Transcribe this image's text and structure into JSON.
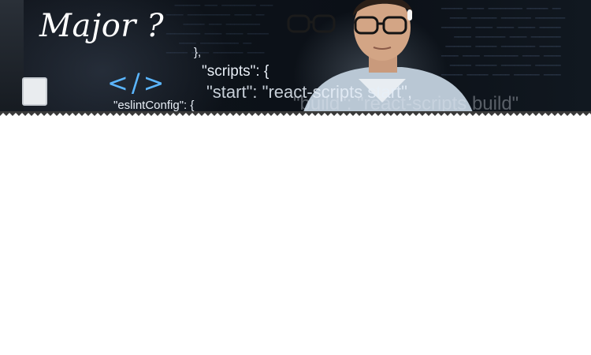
{
  "banner": {
    "title": "Major ?",
    "code_icon": "</>",
    "code_lines": [
      "},",
      "\"scripts\": {",
      "\"start\": \"react-scripts start\",",
      "\"eslintConfig\": {",
      "\"build\": \"react-scripts build\""
    ],
    "accent_color": "#5bb6ff"
  }
}
